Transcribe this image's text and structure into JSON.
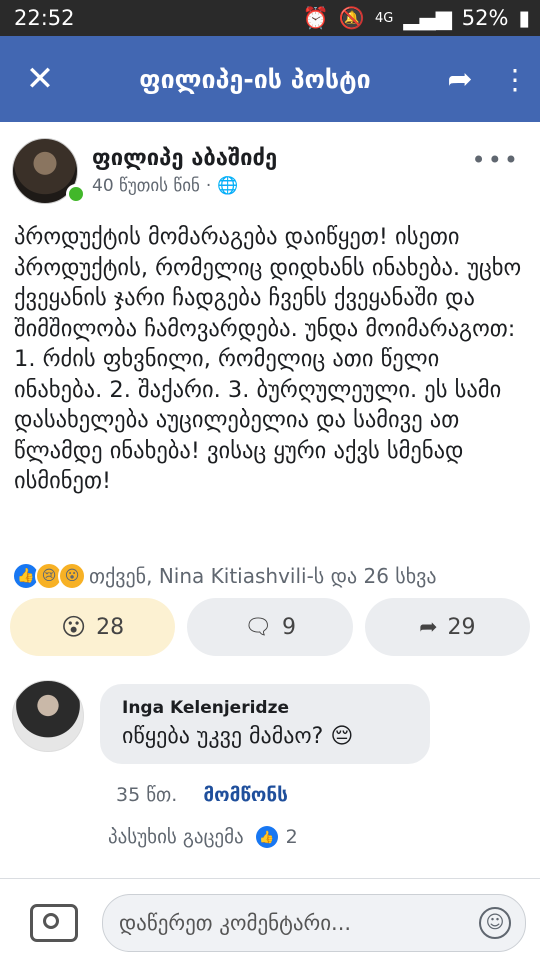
{
  "status_bar": {
    "time": "22:52",
    "network": "4G",
    "battery": "52%"
  },
  "nav": {
    "title": "ფილიპე-ის პოსტი",
    "close_icon": "close-icon",
    "share_icon": "share-arrow-icon",
    "more_icon": "vertical-dots-icon"
  },
  "post": {
    "author": "ფილიპე აბაშიძე",
    "time": "40 წუთის წინ",
    "visibility_icon": "globe-icon",
    "text": "პროდუქტის მომარაგება დაიწყეთ! ისეთი პროდუქტის, რომელიც დიდხანს ინახება. უცხო ქვეყანის ჯარი ჩადგება ჩვენს ქვეყანაში და შიმშილობა ჩამოვარდება. უნდა მოიმარაგოთ: 1. რძის ფხვნილი, რომელიც ათი წელი ინახება. 2. შაქარი. 3. ბურღულეული. ეს სამი დასახელება აუცილებელია და სამივე ათ წლამდე ინახება! ვისაც ყური აქვს სმენად ისმინეთ!",
    "reactions_text": "თქვენ, Nina Kitiashvili-ს და 26 სხვა",
    "buttons": {
      "wow_count": "28",
      "comment_count": "9",
      "share_count": "29"
    }
  },
  "comment": {
    "name": "Inga Kelenjeridze",
    "text": "იწყება უკვე მამაო? 😔",
    "time": "35 წთ.",
    "like_label": "მომწონს",
    "reply_label": "პასუხის გაცემა",
    "like_count": "2"
  },
  "composer": {
    "placeholder": "დაწერეთ კომენტარი..."
  },
  "colors": {
    "nav_bg": "#4267b2",
    "online": "#42b72a",
    "like_blue": "#1877f2"
  }
}
